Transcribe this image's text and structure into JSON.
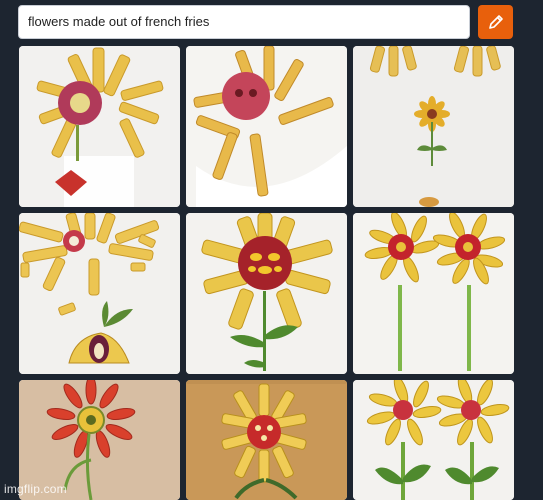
{
  "prompt": {
    "value": "flowers made out of french fries"
  },
  "generate_button": {
    "icon": "pencil-icon",
    "color": "#e8600c"
  },
  "results": {
    "count": 9
  },
  "watermark": {
    "text": "imgflip.com"
  }
}
